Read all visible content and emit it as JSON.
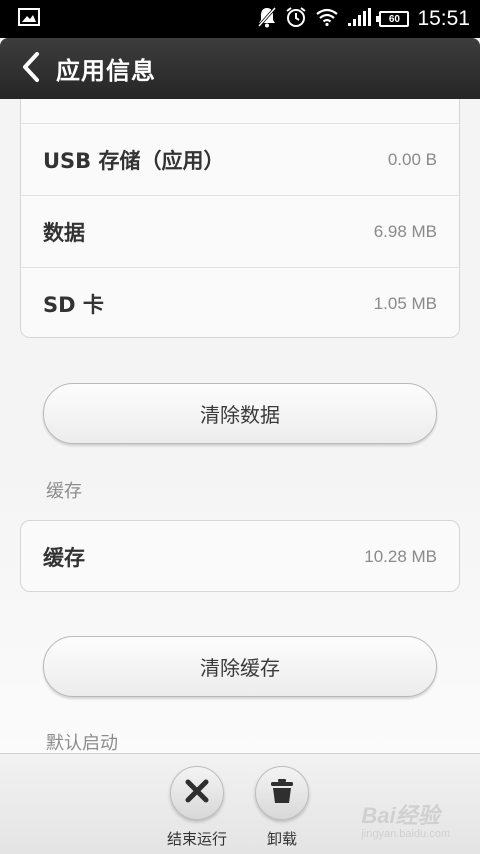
{
  "status_bar": {
    "time": "15:51",
    "battery": "60",
    "icons": [
      "image-icon",
      "notification-muted-icon",
      "alarm-icon",
      "wifi-icon",
      "signal-icon",
      "battery-icon"
    ]
  },
  "header": {
    "title": "应用信息",
    "back_icon": "chevron-left-icon"
  },
  "storage": {
    "rows": [
      {
        "label": "USB 存储（应用）",
        "value": "0.00 B"
      },
      {
        "label": "数据",
        "value": "6.98 MB"
      },
      {
        "label": "SD 卡",
        "value": "1.05 MB"
      }
    ],
    "clear_data_label": "清除数据"
  },
  "cache": {
    "section_label": "缓存",
    "row": {
      "label": "缓存",
      "value": "10.28 MB"
    },
    "clear_cache_label": "清除缓存"
  },
  "default_launch": {
    "section_label": "默认启动"
  },
  "bottom_actions": [
    {
      "label": "结束运行",
      "icon": "close-icon"
    },
    {
      "label": "卸载",
      "icon": "trash-icon"
    }
  ],
  "watermark": {
    "main": "Bai经验",
    "sub": "jingyan.baidu.com"
  },
  "colors": {
    "title_bar": "#2e2e2e",
    "background": "#f4f4f4",
    "value_text": "#8a8a8a"
  }
}
